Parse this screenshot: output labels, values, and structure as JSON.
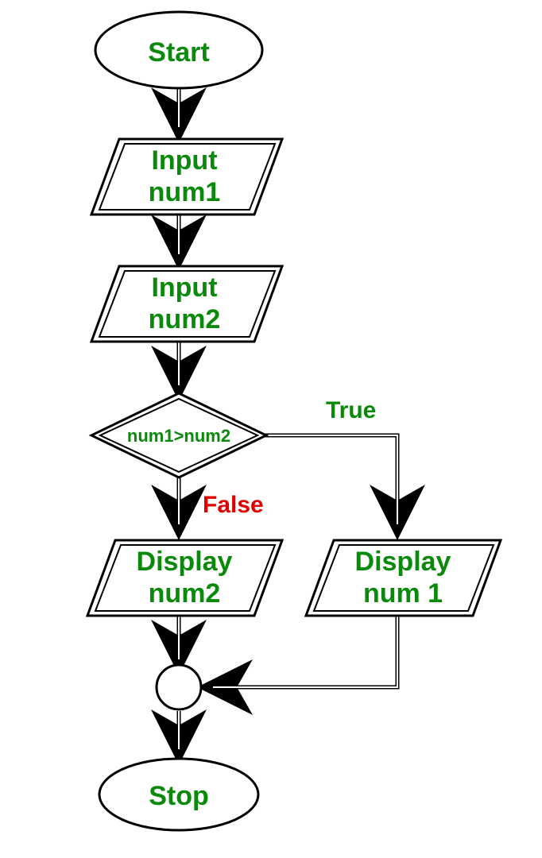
{
  "flowchart": {
    "start": "Start",
    "input1_l1": "Input",
    "input1_l2": "num1",
    "input2_l1": "Input",
    "input2_l2": "num2",
    "decision": "num1>num2",
    "branch_true": "True",
    "branch_false": "False",
    "out_false_l1": "Display",
    "out_false_l2": "num2",
    "out_true_l1": "Display",
    "out_true_l2": "num 1",
    "stop": "Stop"
  }
}
